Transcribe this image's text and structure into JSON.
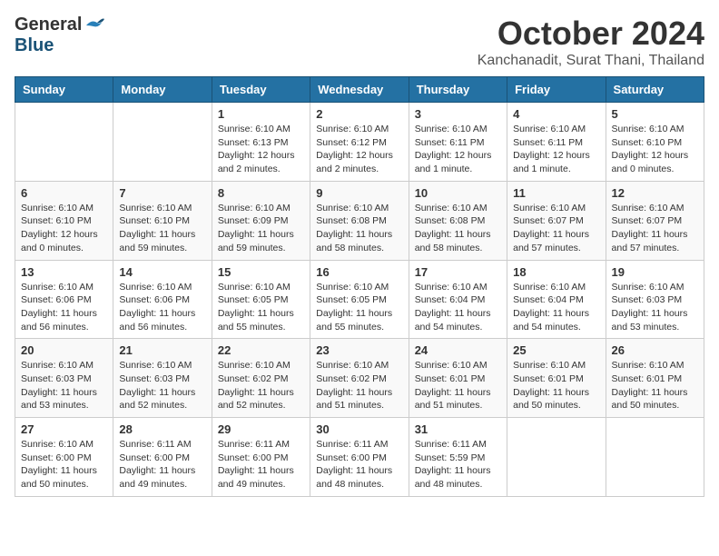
{
  "header": {
    "logo_general": "General",
    "logo_blue": "Blue",
    "month_title": "October 2024",
    "subtitle": "Kanchanadit, Surat Thani, Thailand"
  },
  "weekdays": [
    "Sunday",
    "Monday",
    "Tuesday",
    "Wednesday",
    "Thursday",
    "Friday",
    "Saturday"
  ],
  "weeks": [
    [
      {
        "day": "",
        "info": ""
      },
      {
        "day": "",
        "info": ""
      },
      {
        "day": "1",
        "info": "Sunrise: 6:10 AM\nSunset: 6:13 PM\nDaylight: 12 hours\nand 2 minutes."
      },
      {
        "day": "2",
        "info": "Sunrise: 6:10 AM\nSunset: 6:12 PM\nDaylight: 12 hours\nand 2 minutes."
      },
      {
        "day": "3",
        "info": "Sunrise: 6:10 AM\nSunset: 6:11 PM\nDaylight: 12 hours\nand 1 minute."
      },
      {
        "day": "4",
        "info": "Sunrise: 6:10 AM\nSunset: 6:11 PM\nDaylight: 12 hours\nand 1 minute."
      },
      {
        "day": "5",
        "info": "Sunrise: 6:10 AM\nSunset: 6:10 PM\nDaylight: 12 hours\nand 0 minutes."
      }
    ],
    [
      {
        "day": "6",
        "info": "Sunrise: 6:10 AM\nSunset: 6:10 PM\nDaylight: 12 hours\nand 0 minutes."
      },
      {
        "day": "7",
        "info": "Sunrise: 6:10 AM\nSunset: 6:10 PM\nDaylight: 11 hours\nand 59 minutes."
      },
      {
        "day": "8",
        "info": "Sunrise: 6:10 AM\nSunset: 6:09 PM\nDaylight: 11 hours\nand 59 minutes."
      },
      {
        "day": "9",
        "info": "Sunrise: 6:10 AM\nSunset: 6:08 PM\nDaylight: 11 hours\nand 58 minutes."
      },
      {
        "day": "10",
        "info": "Sunrise: 6:10 AM\nSunset: 6:08 PM\nDaylight: 11 hours\nand 58 minutes."
      },
      {
        "day": "11",
        "info": "Sunrise: 6:10 AM\nSunset: 6:07 PM\nDaylight: 11 hours\nand 57 minutes."
      },
      {
        "day": "12",
        "info": "Sunrise: 6:10 AM\nSunset: 6:07 PM\nDaylight: 11 hours\nand 57 minutes."
      }
    ],
    [
      {
        "day": "13",
        "info": "Sunrise: 6:10 AM\nSunset: 6:06 PM\nDaylight: 11 hours\nand 56 minutes."
      },
      {
        "day": "14",
        "info": "Sunrise: 6:10 AM\nSunset: 6:06 PM\nDaylight: 11 hours\nand 56 minutes."
      },
      {
        "day": "15",
        "info": "Sunrise: 6:10 AM\nSunset: 6:05 PM\nDaylight: 11 hours\nand 55 minutes."
      },
      {
        "day": "16",
        "info": "Sunrise: 6:10 AM\nSunset: 6:05 PM\nDaylight: 11 hours\nand 55 minutes."
      },
      {
        "day": "17",
        "info": "Sunrise: 6:10 AM\nSunset: 6:04 PM\nDaylight: 11 hours\nand 54 minutes."
      },
      {
        "day": "18",
        "info": "Sunrise: 6:10 AM\nSunset: 6:04 PM\nDaylight: 11 hours\nand 54 minutes."
      },
      {
        "day": "19",
        "info": "Sunrise: 6:10 AM\nSunset: 6:03 PM\nDaylight: 11 hours\nand 53 minutes."
      }
    ],
    [
      {
        "day": "20",
        "info": "Sunrise: 6:10 AM\nSunset: 6:03 PM\nDaylight: 11 hours\nand 53 minutes."
      },
      {
        "day": "21",
        "info": "Sunrise: 6:10 AM\nSunset: 6:03 PM\nDaylight: 11 hours\nand 52 minutes."
      },
      {
        "day": "22",
        "info": "Sunrise: 6:10 AM\nSunset: 6:02 PM\nDaylight: 11 hours\nand 52 minutes."
      },
      {
        "day": "23",
        "info": "Sunrise: 6:10 AM\nSunset: 6:02 PM\nDaylight: 11 hours\nand 51 minutes."
      },
      {
        "day": "24",
        "info": "Sunrise: 6:10 AM\nSunset: 6:01 PM\nDaylight: 11 hours\nand 51 minutes."
      },
      {
        "day": "25",
        "info": "Sunrise: 6:10 AM\nSunset: 6:01 PM\nDaylight: 11 hours\nand 50 minutes."
      },
      {
        "day": "26",
        "info": "Sunrise: 6:10 AM\nSunset: 6:01 PM\nDaylight: 11 hours\nand 50 minutes."
      }
    ],
    [
      {
        "day": "27",
        "info": "Sunrise: 6:10 AM\nSunset: 6:00 PM\nDaylight: 11 hours\nand 50 minutes."
      },
      {
        "day": "28",
        "info": "Sunrise: 6:11 AM\nSunset: 6:00 PM\nDaylight: 11 hours\nand 49 minutes."
      },
      {
        "day": "29",
        "info": "Sunrise: 6:11 AM\nSunset: 6:00 PM\nDaylight: 11 hours\nand 49 minutes."
      },
      {
        "day": "30",
        "info": "Sunrise: 6:11 AM\nSunset: 6:00 PM\nDaylight: 11 hours\nand 48 minutes."
      },
      {
        "day": "31",
        "info": "Sunrise: 6:11 AM\nSunset: 5:59 PM\nDaylight: 11 hours\nand 48 minutes."
      },
      {
        "day": "",
        "info": ""
      },
      {
        "day": "",
        "info": ""
      }
    ]
  ]
}
